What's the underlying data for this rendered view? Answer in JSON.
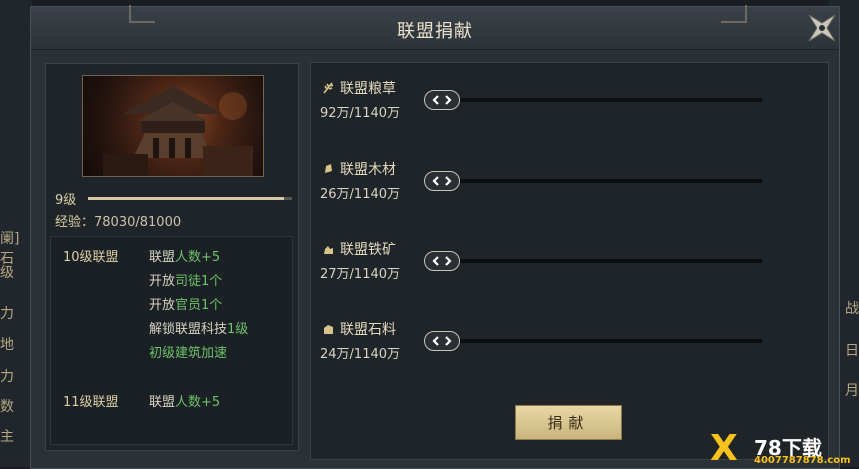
{
  "window": {
    "title": "联盟捐献"
  },
  "background": {
    "left_fragments": [
      "阑]石",
      "级",
      "力",
      "地",
      "力",
      "数",
      "主"
    ],
    "right_fragments": [
      "战",
      "日",
      "月"
    ]
  },
  "alliance": {
    "level": "9级",
    "level_progress": 0.963,
    "exp_label": "经验：",
    "exp_value": "78030/81000"
  },
  "rewards": [
    {
      "level": "10级联盟",
      "lines": [
        {
          "text": "联盟",
          "highlight": "人数+5"
        },
        {
          "text": "开放",
          "highlight": "司徒1个"
        },
        {
          "text": "开放",
          "highlight": "官员1个"
        },
        {
          "text": "解锁联盟科技",
          "highlight": "1级"
        },
        {
          "text": "",
          "highlight": "初级建筑加速"
        }
      ]
    },
    {
      "level": "11级联盟",
      "lines": [
        {
          "text": "联盟",
          "highlight": "人数+5"
        }
      ]
    }
  ],
  "resources": [
    {
      "name": "联盟粮草",
      "count": "92万/1140万",
      "icon": "wheat-icon"
    },
    {
      "name": "联盟木材",
      "count": "26万/1140万",
      "icon": "wood-icon"
    },
    {
      "name": "联盟铁矿",
      "count": "27万/1140万",
      "icon": "iron-ore-icon"
    },
    {
      "name": "联盟石料",
      "count": "24万/1140万",
      "icon": "stone-icon"
    }
  ],
  "actions": {
    "donate_label": "捐献"
  },
  "watermark": {
    "title": "78下载",
    "site": "4007787878.com"
  },
  "colors": {
    "accent_gold": "#d9cfa6",
    "highlight_green": "#6ec16b",
    "button_gold": "#e0cd96"
  }
}
